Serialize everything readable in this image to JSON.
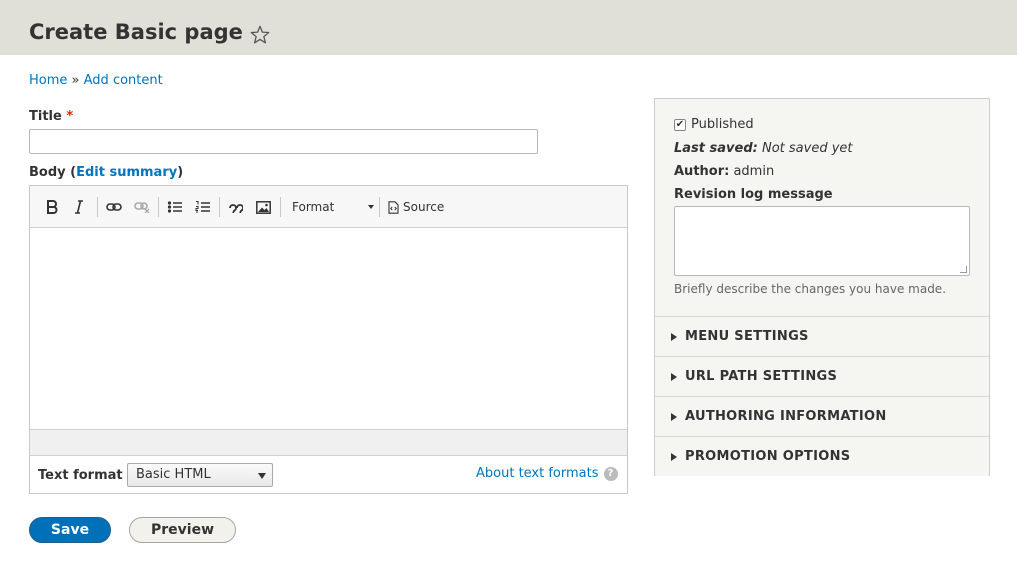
{
  "header": {
    "title": "Create Basic page"
  },
  "breadcrumb": {
    "home": "Home",
    "separator": "»",
    "current": "Add content"
  },
  "form": {
    "title_label": "Title",
    "required_mark": "*",
    "title_value": "",
    "body_label": "Body (",
    "edit_summary": "Edit summary",
    "body_label_end": ")",
    "toolbar": {
      "format_label": "Format",
      "source_label": "Source"
    },
    "text_format_label": "Text format",
    "text_format_value": "Basic HTML",
    "about_formats": "About text formats",
    "help_glyph": "?"
  },
  "actions": {
    "save": "Save",
    "preview": "Preview"
  },
  "sidebar": {
    "published_label": "Published",
    "published_checked": true,
    "last_saved_label": "Last saved:",
    "last_saved_value": "Not saved yet",
    "author_label": "Author:",
    "author_value": "admin",
    "revision_label": "Revision log message",
    "revision_value": "",
    "revision_desc": "Briefly describe the changes you have made.",
    "sections": [
      {
        "label": "MENU SETTINGS"
      },
      {
        "label": "URL PATH SETTINGS"
      },
      {
        "label": "AUTHORING INFORMATION"
      },
      {
        "label": "PROMOTION OPTIONS"
      }
    ]
  },
  "colors": {
    "link": "#0074bd",
    "save_button": "#0071b8",
    "header_bg": "#e0e0d8",
    "required": "#e32700"
  }
}
